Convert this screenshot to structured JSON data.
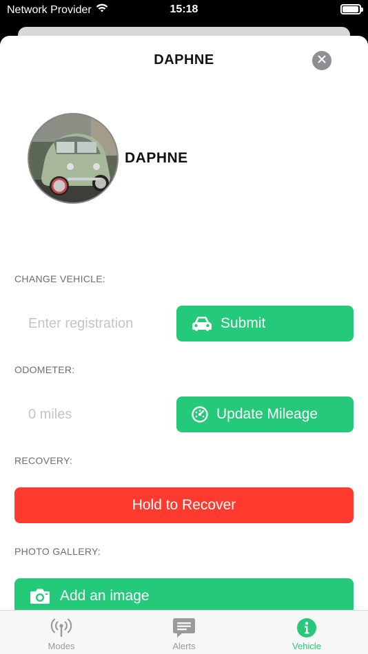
{
  "status": {
    "carrier": "Network Provider",
    "time": "15:18",
    "battery_level": 0.95
  },
  "sheet": {
    "title": "DAPHNE",
    "close_icon": "close-icon"
  },
  "vehicle": {
    "name": "DAPHNE",
    "photo_icon": "car-photo"
  },
  "change_vehicle": {
    "label": "CHANGE VEHICLE:",
    "placeholder": "Enter registration",
    "value": "",
    "button_label": "Submit",
    "button_icon": "car-icon"
  },
  "odometer": {
    "label": "ODOMETER:",
    "placeholder": "0 miles",
    "value": "",
    "button_label": "Update Mileage",
    "button_icon": "speedometer-icon"
  },
  "recovery": {
    "label": "RECOVERY:",
    "button_label": "Hold to Recover"
  },
  "gallery": {
    "label": "PHOTO GALLERY:",
    "button_label": "Add an image",
    "button_icon": "camera-icon"
  },
  "tabs": [
    {
      "label": "Modes",
      "icon": "antenna-icon",
      "active": false
    },
    {
      "label": "Alerts",
      "icon": "chat-bubble-icon",
      "active": false
    },
    {
      "label": "Vehicle",
      "icon": "info-icon",
      "active": true
    }
  ],
  "colors": {
    "accent": "#25c97a",
    "danger": "#ff3b30",
    "inactive": "#9a9a9a"
  }
}
